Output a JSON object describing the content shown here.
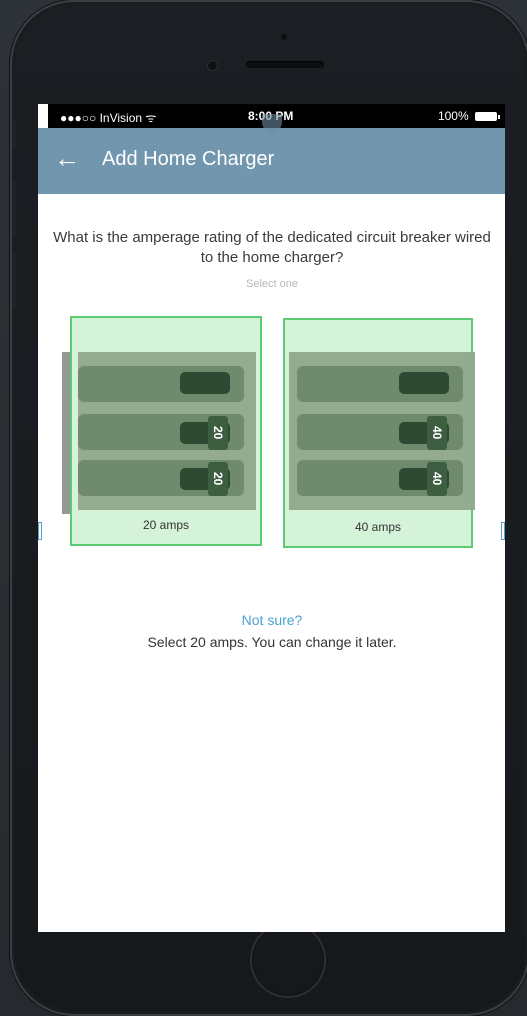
{
  "statusbar": {
    "carrier": "●●●○○ InVision ᯤ",
    "time": "8:00 PM",
    "battery": "100%"
  },
  "appbar": {
    "back_icon": "←",
    "title": "Add Home Charger"
  },
  "question": "What is the amperage rating of the dedicated circuit breaker wired to the home charger?",
  "hint": "Select one",
  "options": [
    {
      "label": "20 amps",
      "tag": "20"
    },
    {
      "label": "40 amps",
      "tag": "40"
    }
  ],
  "help": {
    "link": "Not sure?",
    "text": "Select 20 amps. You can change it later."
  },
  "colors": {
    "appbar": "#7196ad",
    "card_fill": "#d5f3d8",
    "card_border": "#5ccb74",
    "link": "#4aa3d0"
  }
}
